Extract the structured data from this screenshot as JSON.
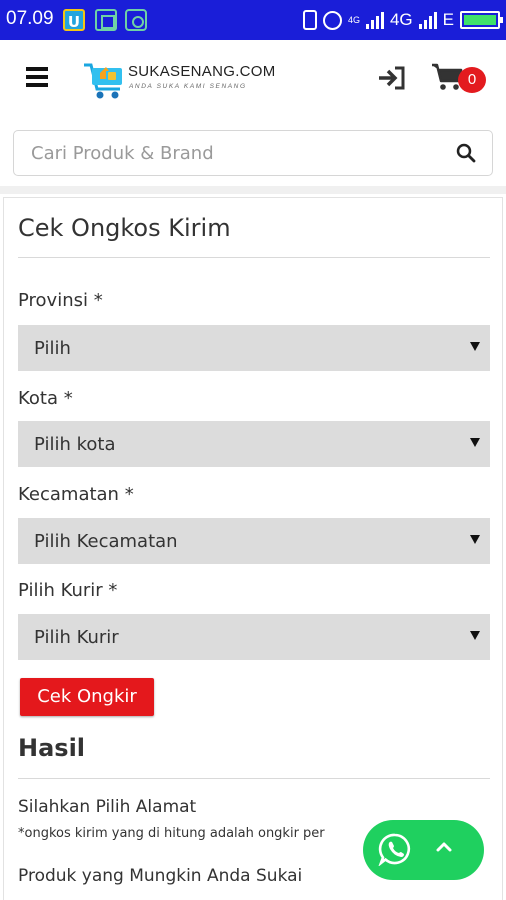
{
  "status_bar": {
    "time": "07.09",
    "app_icons": [
      "u-app-icon",
      "scan-icon",
      "cast-icon"
    ],
    "net_small": "4G",
    "net_type": "4G",
    "net_type2": "E"
  },
  "header": {
    "logo_text": "SUKASENANG.COM",
    "logo_tagline": "ANDA SUKA KAMI SENANG",
    "cart_count": "0",
    "icons": [
      "menu-icon",
      "login-icon",
      "cart-icon"
    ]
  },
  "search": {
    "placeholder": "Cari Produk & Brand",
    "value": ""
  },
  "form": {
    "title": "Cek Ongkos Kirim",
    "fields": [
      {
        "label": "Provinsi *",
        "value": "Pilih"
      },
      {
        "label": "Kota *",
        "value": "Pilih kota"
      },
      {
        "label": "Kecamatan *",
        "value": "Pilih Kecamatan"
      },
      {
        "label": "Pilih Kurir *",
        "value": "Pilih Kurir"
      }
    ],
    "submit_label": "Cek Ongkir"
  },
  "result": {
    "title": "Hasil",
    "message": "Silahkan Pilih Alamat",
    "note": "*ongkos kirim yang di hitung adalah ongkir per"
  },
  "recommendations": {
    "title": "Produk yang Mungkin Anda Sukai"
  },
  "colors": {
    "status_bar": "#1a1ed8",
    "accent_red": "#e4181c",
    "whatsapp_green": "#1fd05f",
    "select_bg": "#dcdcdc"
  }
}
